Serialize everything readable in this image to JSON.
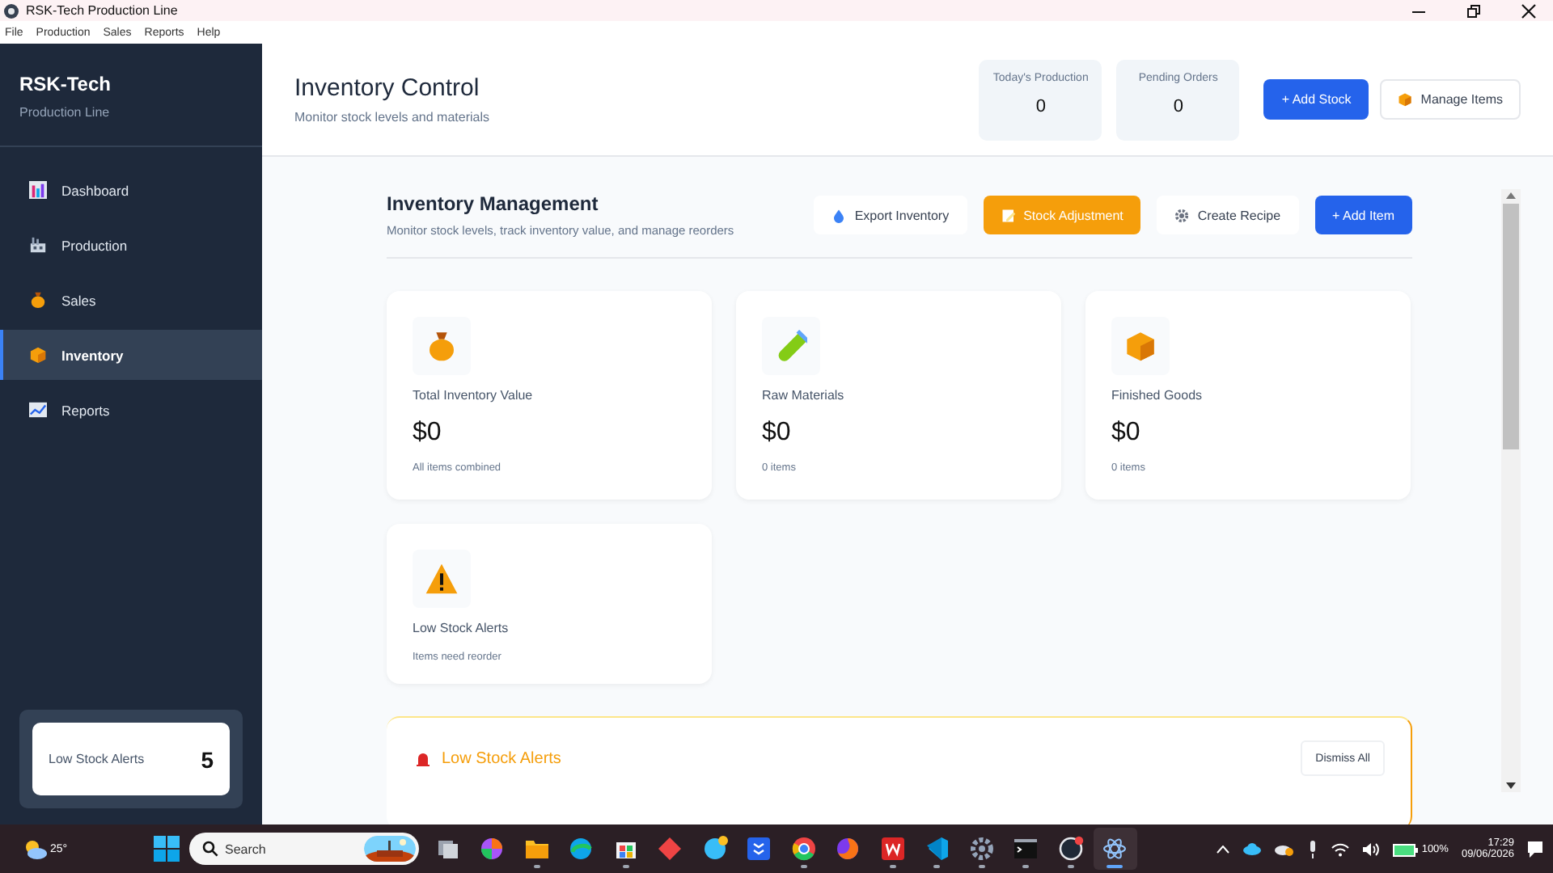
{
  "window": {
    "title": "RSK-Tech Production Line"
  },
  "menu": [
    "File",
    "Production",
    "Sales",
    "Reports",
    "Help"
  ],
  "sidebar": {
    "brand": "RSK-Tech",
    "subtitle": "Production Line",
    "items": [
      {
        "label": "Dashboard",
        "kind": "chart",
        "selected": false
      },
      {
        "label": "Production",
        "kind": "factory",
        "selected": false
      },
      {
        "label": "Sales",
        "kind": "moneybag",
        "selected": false
      },
      {
        "label": "Inventory",
        "kind": "box",
        "selected": true
      },
      {
        "label": "Reports",
        "kind": "report",
        "selected": false
      }
    ],
    "alert": {
      "label": "Low Stock Alerts",
      "count": "5"
    }
  },
  "header": {
    "title": "Inventory Control",
    "subtitle": "Monitor stock levels and materials",
    "stats": [
      {
        "label": "Today's Production",
        "value": "0"
      },
      {
        "label": "Pending Orders",
        "value": "0"
      }
    ],
    "buttons": [
      {
        "label": "+ Add Stock",
        "kind": "primary"
      },
      {
        "label": "Manage Items",
        "kind": "box"
      }
    ]
  },
  "section": {
    "title": "Inventory Management",
    "subtitle": "Monitor stock levels, track inventory value, and manage reorders",
    "buttons": [
      {
        "label": "Export Inventory",
        "kind": "drop"
      },
      {
        "label": "Stock Adjustment",
        "kind": "warning"
      },
      {
        "label": "Create Recipe",
        "kind": "gear"
      },
      {
        "label": "+ Add Item",
        "kind": "primary"
      }
    ]
  },
  "cards": [
    {
      "kind": "moneybag",
      "label": "Total Inventory Value",
      "value": "$0",
      "note": "All items combined"
    },
    {
      "kind": "testtube",
      "label": "Raw Materials",
      "value": "$0",
      "note": "0 items"
    },
    {
      "kind": "box",
      "label": "Finished Goods",
      "value": "$0",
      "note": "0 items"
    },
    {
      "kind": "warning",
      "label": "Low Stock Alerts",
      "note": "Items need reorder"
    }
  ],
  "alerts_panel": {
    "title": "Low Stock Alerts",
    "button": "Dismiss All"
  },
  "taskbar": {
    "weather": "25°",
    "search_placeholder": "Search",
    "apps": [
      {
        "running": false,
        "selected": false
      },
      {
        "running": false,
        "selected": false
      },
      {
        "running": true,
        "selected": false
      },
      {
        "running": false,
        "selected": false
      },
      {
        "running": true,
        "selected": false
      },
      {
        "running": false,
        "selected": false
      },
      {
        "running": false,
        "selected": false
      },
      {
        "running": false,
        "selected": false
      },
      {
        "running": true,
        "selected": false
      },
      {
        "running": false,
        "selected": false
      },
      {
        "running": true,
        "selected": false
      },
      {
        "running": true,
        "selected": false
      },
      {
        "running": true,
        "selected": false
      },
      {
        "running": true,
        "selected": false
      },
      {
        "running": true,
        "selected": false
      },
      {
        "running": true,
        "selected": true
      }
    ],
    "battery": "100%",
    "time": "17:29",
    "date": "09/06/2026"
  }
}
